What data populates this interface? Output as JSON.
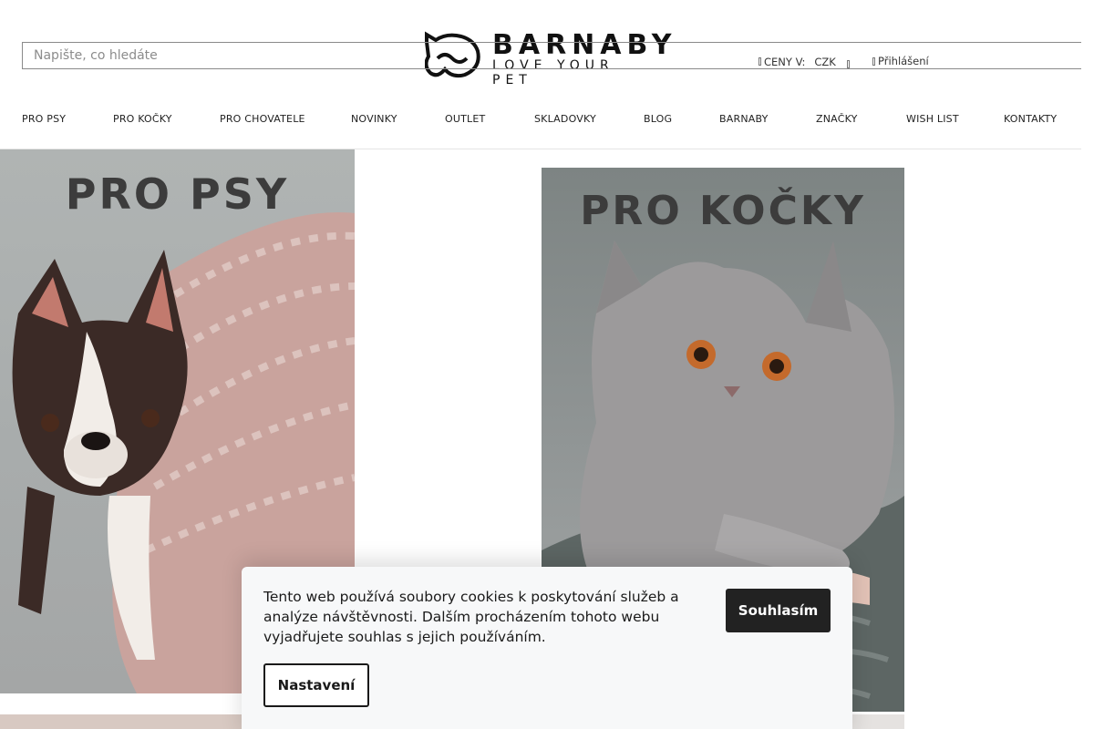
{
  "header": {
    "logo_brand": "BARNABY",
    "logo_tagline": "LOVE YOUR PET",
    "search_placeholder": "Napište, co hledáte",
    "prices_label": "CENY V:",
    "currency": "CZK",
    "login_label": "Přihlášení"
  },
  "nav": {
    "items": [
      "PRO PSY",
      "PRO KOČKY",
      "PRO CHOVATELE",
      "NOVINKY",
      "OUTLET",
      "SKLADOVKY",
      "BLOG",
      "BARNABY",
      "ZNAČKY",
      "WISH LIST",
      "KONTAKTY"
    ]
  },
  "tiles": {
    "dogs": "PRO PSY",
    "cats": "PRO KOČKY"
  },
  "cookie": {
    "text": "Tento web používá soubory cookies k poskytování služeb a analýze návštěvnosti. Dalším procházením tohoto webu vyjadřujete souhlas s jejich používáním.",
    "agree_label": "Souhlasím",
    "settings_label": "Nastavení"
  },
  "colors": {
    "accent_dark": "#222222",
    "banner_bg": "#f7f8f9"
  }
}
